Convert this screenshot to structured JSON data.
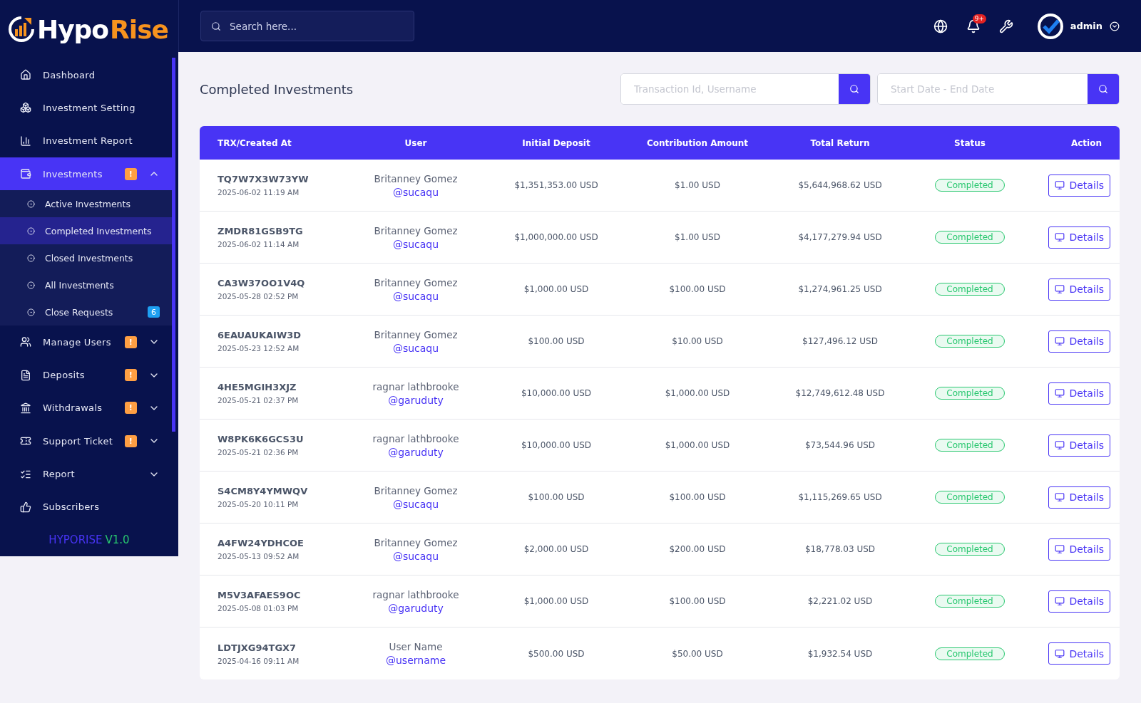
{
  "brand": {
    "name_first": "Hypo",
    "name_second": "Rise"
  },
  "topbar": {
    "search": {
      "placeholder": "Search here..."
    },
    "notifications": {
      "badge": "9+"
    },
    "user": {
      "name": "admin"
    }
  },
  "sidebar": {
    "items": [
      {
        "label": "Dashboard",
        "selected": false
      },
      {
        "label": "Investment Setting",
        "selected": false
      },
      {
        "label": "Investment Report",
        "selected": false
      },
      {
        "label": "Investments",
        "selected": true,
        "badge": "!",
        "expanded": true,
        "children": [
          {
            "label": "Active Investments",
            "selected": false
          },
          {
            "label": "Completed Investments",
            "selected": true
          },
          {
            "label": "Closed Investments",
            "selected": false
          },
          {
            "label": "All Investments",
            "selected": false
          },
          {
            "label": "Close Requests",
            "selected": false,
            "badge": "6"
          }
        ]
      },
      {
        "label": "Manage Users",
        "selected": false,
        "badge": "!",
        "expanded": false
      },
      {
        "label": "Deposits",
        "selected": false,
        "badge": "!",
        "expanded": false
      },
      {
        "label": "Withdrawals",
        "selected": false,
        "badge": "!",
        "expanded": false
      },
      {
        "label": "Support Ticket",
        "selected": false,
        "badge": "!",
        "expanded": false
      },
      {
        "label": "Report",
        "selected": false,
        "expanded": false
      },
      {
        "label": "Subscribers",
        "selected": false
      }
    ],
    "footer": {
      "name": "HYPORISE",
      "version": "V1.0"
    }
  },
  "page": {
    "title": "Completed Investments",
    "filters": [
      {
        "placeholder": "Transaction Id, Username"
      },
      {
        "placeholder": "Start Date - End Date"
      }
    ]
  },
  "table": {
    "columns": [
      "TRX/Created At",
      "User",
      "Initial Deposit",
      "Contribution Amount",
      "Total Return",
      "Status",
      "Action"
    ],
    "rows": [
      {
        "trx": "TQ7W7X3W73YW",
        "created_at": "2025-06-02 11:19 AM",
        "user_name": "Britanney Gomez",
        "username": "@sucaqu",
        "initial_deposit": "$1,351,353.00 USD",
        "contribution": "$1.00 USD",
        "total_return": "$5,644,968.62 USD",
        "status": "Completed",
        "action": "Details"
      },
      {
        "trx": "ZMDR81GSB9TG",
        "created_at": "2025-06-02 11:14 AM",
        "user_name": "Britanney Gomez",
        "username": "@sucaqu",
        "initial_deposit": "$1,000,000.00 USD",
        "contribution": "$1.00 USD",
        "total_return": "$4,177,279.94 USD",
        "status": "Completed",
        "action": "Details"
      },
      {
        "trx": "CA3W37OO1V4Q",
        "created_at": "2025-05-28 02:52 PM",
        "user_name": "Britanney Gomez",
        "username": "@sucaqu",
        "initial_deposit": "$1,000.00 USD",
        "contribution": "$100.00 USD",
        "total_return": "$1,274,961.25 USD",
        "status": "Completed",
        "action": "Details"
      },
      {
        "trx": "6EAUAUKAIW3D",
        "created_at": "2025-05-23 12:52 AM",
        "user_name": "Britanney Gomez",
        "username": "@sucaqu",
        "initial_deposit": "$100.00 USD",
        "contribution": "$10.00 USD",
        "total_return": "$127,496.12 USD",
        "status": "Completed",
        "action": "Details"
      },
      {
        "trx": "4HE5MGIH3XJZ",
        "created_at": "2025-05-21 02:37 PM",
        "user_name": "ragnar lathbrooke",
        "username": "@garuduty",
        "initial_deposit": "$10,000.00 USD",
        "contribution": "$1,000.00 USD",
        "total_return": "$12,749,612.48 USD",
        "status": "Completed",
        "action": "Details"
      },
      {
        "trx": "W8PK6K6GCS3U",
        "created_at": "2025-05-21 02:36 PM",
        "user_name": "ragnar lathbrooke",
        "username": "@garuduty",
        "initial_deposit": "$10,000.00 USD",
        "contribution": "$1,000.00 USD",
        "total_return": "$73,544.96 USD",
        "status": "Completed",
        "action": "Details"
      },
      {
        "trx": "S4CM8Y4YMWQV",
        "created_at": "2025-05-20 10:11 PM",
        "user_name": "Britanney Gomez",
        "username": "@sucaqu",
        "initial_deposit": "$100.00 USD",
        "contribution": "$100.00 USD",
        "total_return": "$1,115,269.65 USD",
        "status": "Completed",
        "action": "Details"
      },
      {
        "trx": "A4FW24YDHCOE",
        "created_at": "2025-05-13 09:52 AM",
        "user_name": "Britanney Gomez",
        "username": "@sucaqu",
        "initial_deposit": "$2,000.00 USD",
        "contribution": "$200.00 USD",
        "total_return": "$18,778.03 USD",
        "status": "Completed",
        "action": "Details"
      },
      {
        "trx": "M5V3AFAES9OC",
        "created_at": "2025-05-08 01:03 PM",
        "user_name": "ragnar lathbrooke",
        "username": "@garuduty",
        "initial_deposit": "$1,000.00 USD",
        "contribution": "$100.00 USD",
        "total_return": "$2,221.02 USD",
        "status": "Completed",
        "action": "Details"
      },
      {
        "trx": "LDTJXG94TGX7",
        "created_at": "2025-04-16 09:11 AM",
        "user_name": "User Name",
        "username": "@username",
        "initial_deposit": "$500.00 USD",
        "contribution": "$50.00 USD",
        "total_return": "$1,932.54 USD",
        "status": "Completed",
        "action": "Details"
      }
    ]
  }
}
